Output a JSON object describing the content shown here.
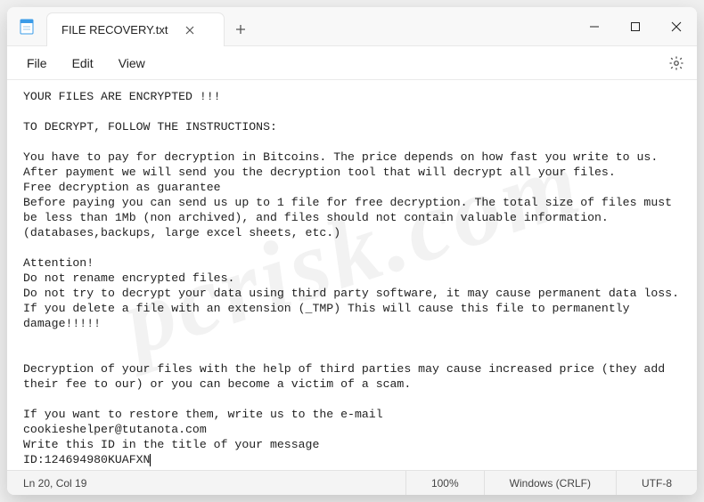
{
  "titlebar": {
    "tab_title": "FILE RECOVERY.txt"
  },
  "menu": {
    "file": "File",
    "edit": "Edit",
    "view": "View"
  },
  "body": {
    "l1": "YOUR FILES ARE ENCRYPTED !!!",
    "l2": "TO DECRYPT, FOLLOW THE INSTRUCTIONS:",
    "l3": "You have to pay for decryption in Bitcoins. The price depends on how fast you write to us.",
    "l4": "After payment we will send you the decryption tool that will decrypt all your files.",
    "l5": "Free decryption as guarantee",
    "l6": "Before paying you can send us up to 1 file for free decryption. The total size of files must be less than 1Mb (non archived), and files should not contain valuable information.",
    "l7": "(databases,backups, large excel sheets, etc.)",
    "l8": "Attention!",
    "l9": "Do not rename encrypted files.",
    "l10": "Do not try to decrypt your data using third party software, it may cause permanent data loss.",
    "l11": "If you delete a file with an extension (_TMP) This will cause this file to permanently damage!!!!!",
    "l12": "Decryption of your files with the help of third parties may cause increased price (they add their fee to our) or you can become a victim of a scam.",
    "l13": "If you want to restore them, write us to the e-mail",
    "l14": "cookieshelper@tutanota.com",
    "l15": "Write this ID in the title of your message",
    "l16": "ID:124694980KUAFXN"
  },
  "status": {
    "cursor": "Ln 20, Col 19",
    "zoom": "100%",
    "line_ending": "Windows (CRLF)",
    "encoding": "UTF-8"
  },
  "watermark": "pcrisk.com"
}
